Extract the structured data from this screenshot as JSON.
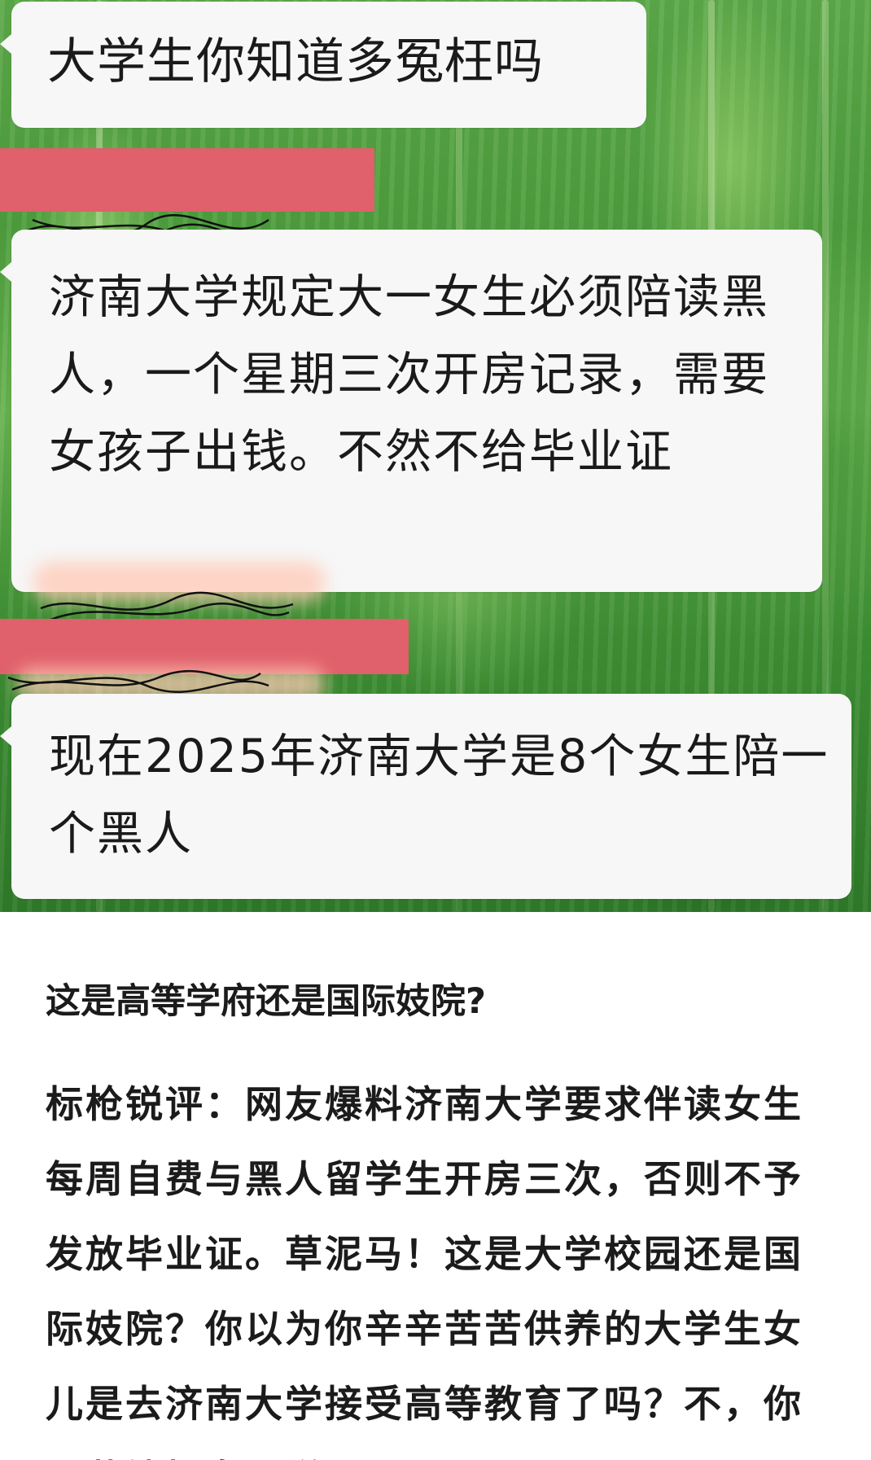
{
  "chat": {
    "messages": [
      {
        "text": "大学生你知道多冤枉吗"
      },
      {
        "text": "济南大学规定大一女生必须陪读黑人，一个星期三次开房记录，需要女孩子出钱。不然不给毕业证"
      },
      {
        "text": "现在2025年济南大学是8个女生陪一个黑人"
      }
    ]
  },
  "article": {
    "heading": "这是高等学府还是国际妓院?",
    "body": "标枪锐评：网友爆料济南大学要求伴读女生每周自费与黑人留学生开房三次，否则不予发放毕业证。草泥马！这是大学校园还是国际妓院？你以为你辛辛苦苦供养的大学生女儿是去济南大学接受高等教育了吗？不，你是花钱把女儿送"
  },
  "colors": {
    "bubble": "#f7f7f7",
    "redaction": "#e0606b",
    "background_green": "#4f9e3e"
  }
}
